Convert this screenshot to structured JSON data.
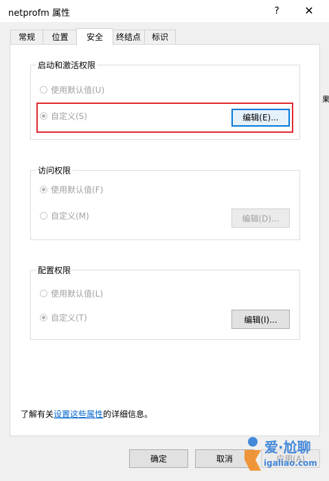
{
  "window": {
    "title": "netprofm 属性",
    "help_label": "?",
    "close_label": "✕"
  },
  "tabs": [
    {
      "label": "常规"
    },
    {
      "label": "位置"
    },
    {
      "label": "安全"
    },
    {
      "label": "终结点"
    },
    {
      "label": "标识"
    }
  ],
  "groups": {
    "launch": {
      "label": "启动和激活权限",
      "default_label": "使用默认值(U)",
      "custom_label": "自定义(S)",
      "edit_label": "编辑(E)..."
    },
    "access": {
      "label": "访问权限",
      "default_label": "使用默认值(F)",
      "custom_label": "自定义(M)",
      "edit_label": "编辑(D)..."
    },
    "config": {
      "label": "配置权限",
      "default_label": "使用默认值(L)",
      "custom_label": "自定义(T)",
      "edit_label": "编辑(I)..."
    }
  },
  "info": {
    "prefix": "了解有关",
    "link": "设置这些属性",
    "suffix": "的详细信息。"
  },
  "buttons": {
    "ok": "确定",
    "cancel": "取消",
    "apply": "应用(A)"
  },
  "watermark": {
    "brand": "爱·尬聊",
    "domain": "igaliao.com"
  },
  "background_fragments": {
    "right_cut": "果"
  },
  "colors": {
    "highlight_border": "#e0262e",
    "link": "#0066cc",
    "focus": "#0078d7"
  }
}
